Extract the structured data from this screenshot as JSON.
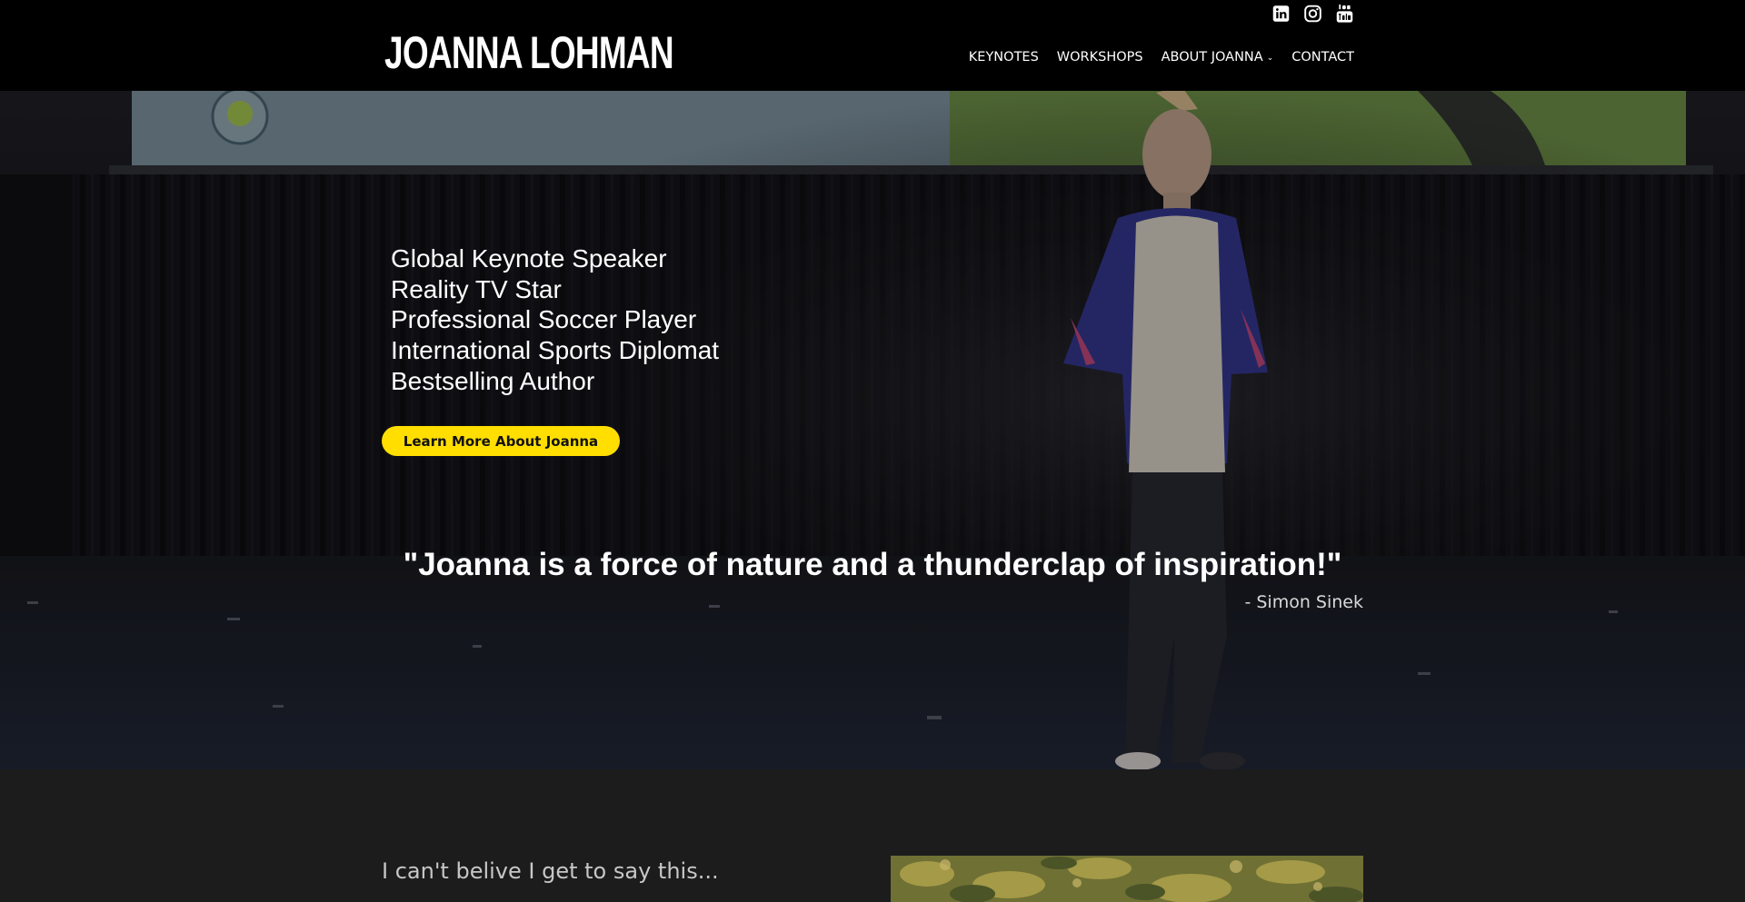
{
  "header": {
    "logo": "JOANNA LOHMAN",
    "socials": [
      {
        "icon": "linkedin-icon"
      },
      {
        "icon": "instagram-icon"
      },
      {
        "icon": "youtube-icon"
      }
    ],
    "nav": [
      {
        "label": "KEYNOTES"
      },
      {
        "label": "WORKSHOPS"
      },
      {
        "label": "ABOUT JOANNA",
        "dropdown": true
      },
      {
        "label": "CONTACT"
      }
    ]
  },
  "hero": {
    "roles": [
      "Global Keynote Speaker",
      "Reality TV Star",
      "Professional Soccer Player",
      "International Sports Diplomat",
      "Bestselling Author"
    ],
    "cta_label": "Learn More About Joanna",
    "quote": "\"Joanna is a force of nature and a thunderclap of inspiration!\"",
    "attribution": "- Simon Sinek"
  },
  "intro": {
    "heading": "I can't belive I get to say this..."
  },
  "colors": {
    "accent": "#ffde00",
    "header_bg": "#000000",
    "section_bg": "#1c1c1c"
  }
}
